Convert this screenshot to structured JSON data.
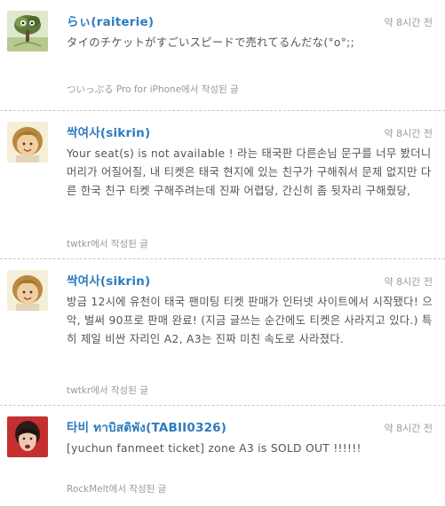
{
  "tweets": [
    {
      "user": "らぃ(raiterie)",
      "time": "약 8시간 전",
      "text": "タイのチケットがすごいスピードで売れてるんだな(°o°;;",
      "source": "ついっぷる Pro for iPhone에서 작성된 글",
      "avatar": "tree-avatar-icon"
    },
    {
      "user": "싹여사(sikrin)",
      "time": "약 8시간 전",
      "text": "Your seat(s) is not available ! 라는 태국판 다른손님 문구를 너무 봤더니 머리가 어질어질, 내 티켓은 태국 현지에 있는 친구가 구해줘서 문제 없지만 다른 한국 친구 티켓 구해주려는데 진짜 어렵당, 간신히 좀 뒷자리 구해줬당,",
      "source": "twtkr에서 작성된 글",
      "avatar": "person-avatar-icon"
    },
    {
      "user": "싹여사(sikrin)",
      "time": "약 8시간 전",
      "text": "방금 12시에 유천이 태국 팬미팅 티켓 판매가 인터넷 사이트에서 시작됐다! 으악, 벌써 90프로 판매 완료! (지금 글쓰는 순간에도 티켓은 사라지고 있다.) 특히 제일 비싼 자리인 A2, A3는 진짜 미친 속도로 사라졌다.",
      "source": "twtkr에서 작성된 글",
      "avatar": "person-avatar-icon"
    },
    {
      "user": "타비 ทาบิสติพัง(TABII0326)",
      "time": "약 8시간 전",
      "text": "[yuchun fanmeet ticket] zone A3 is SOLD OUT !!!!!!",
      "source": "RockMelt에서 작성된 글",
      "avatar": "person-avatar-icon"
    }
  ]
}
